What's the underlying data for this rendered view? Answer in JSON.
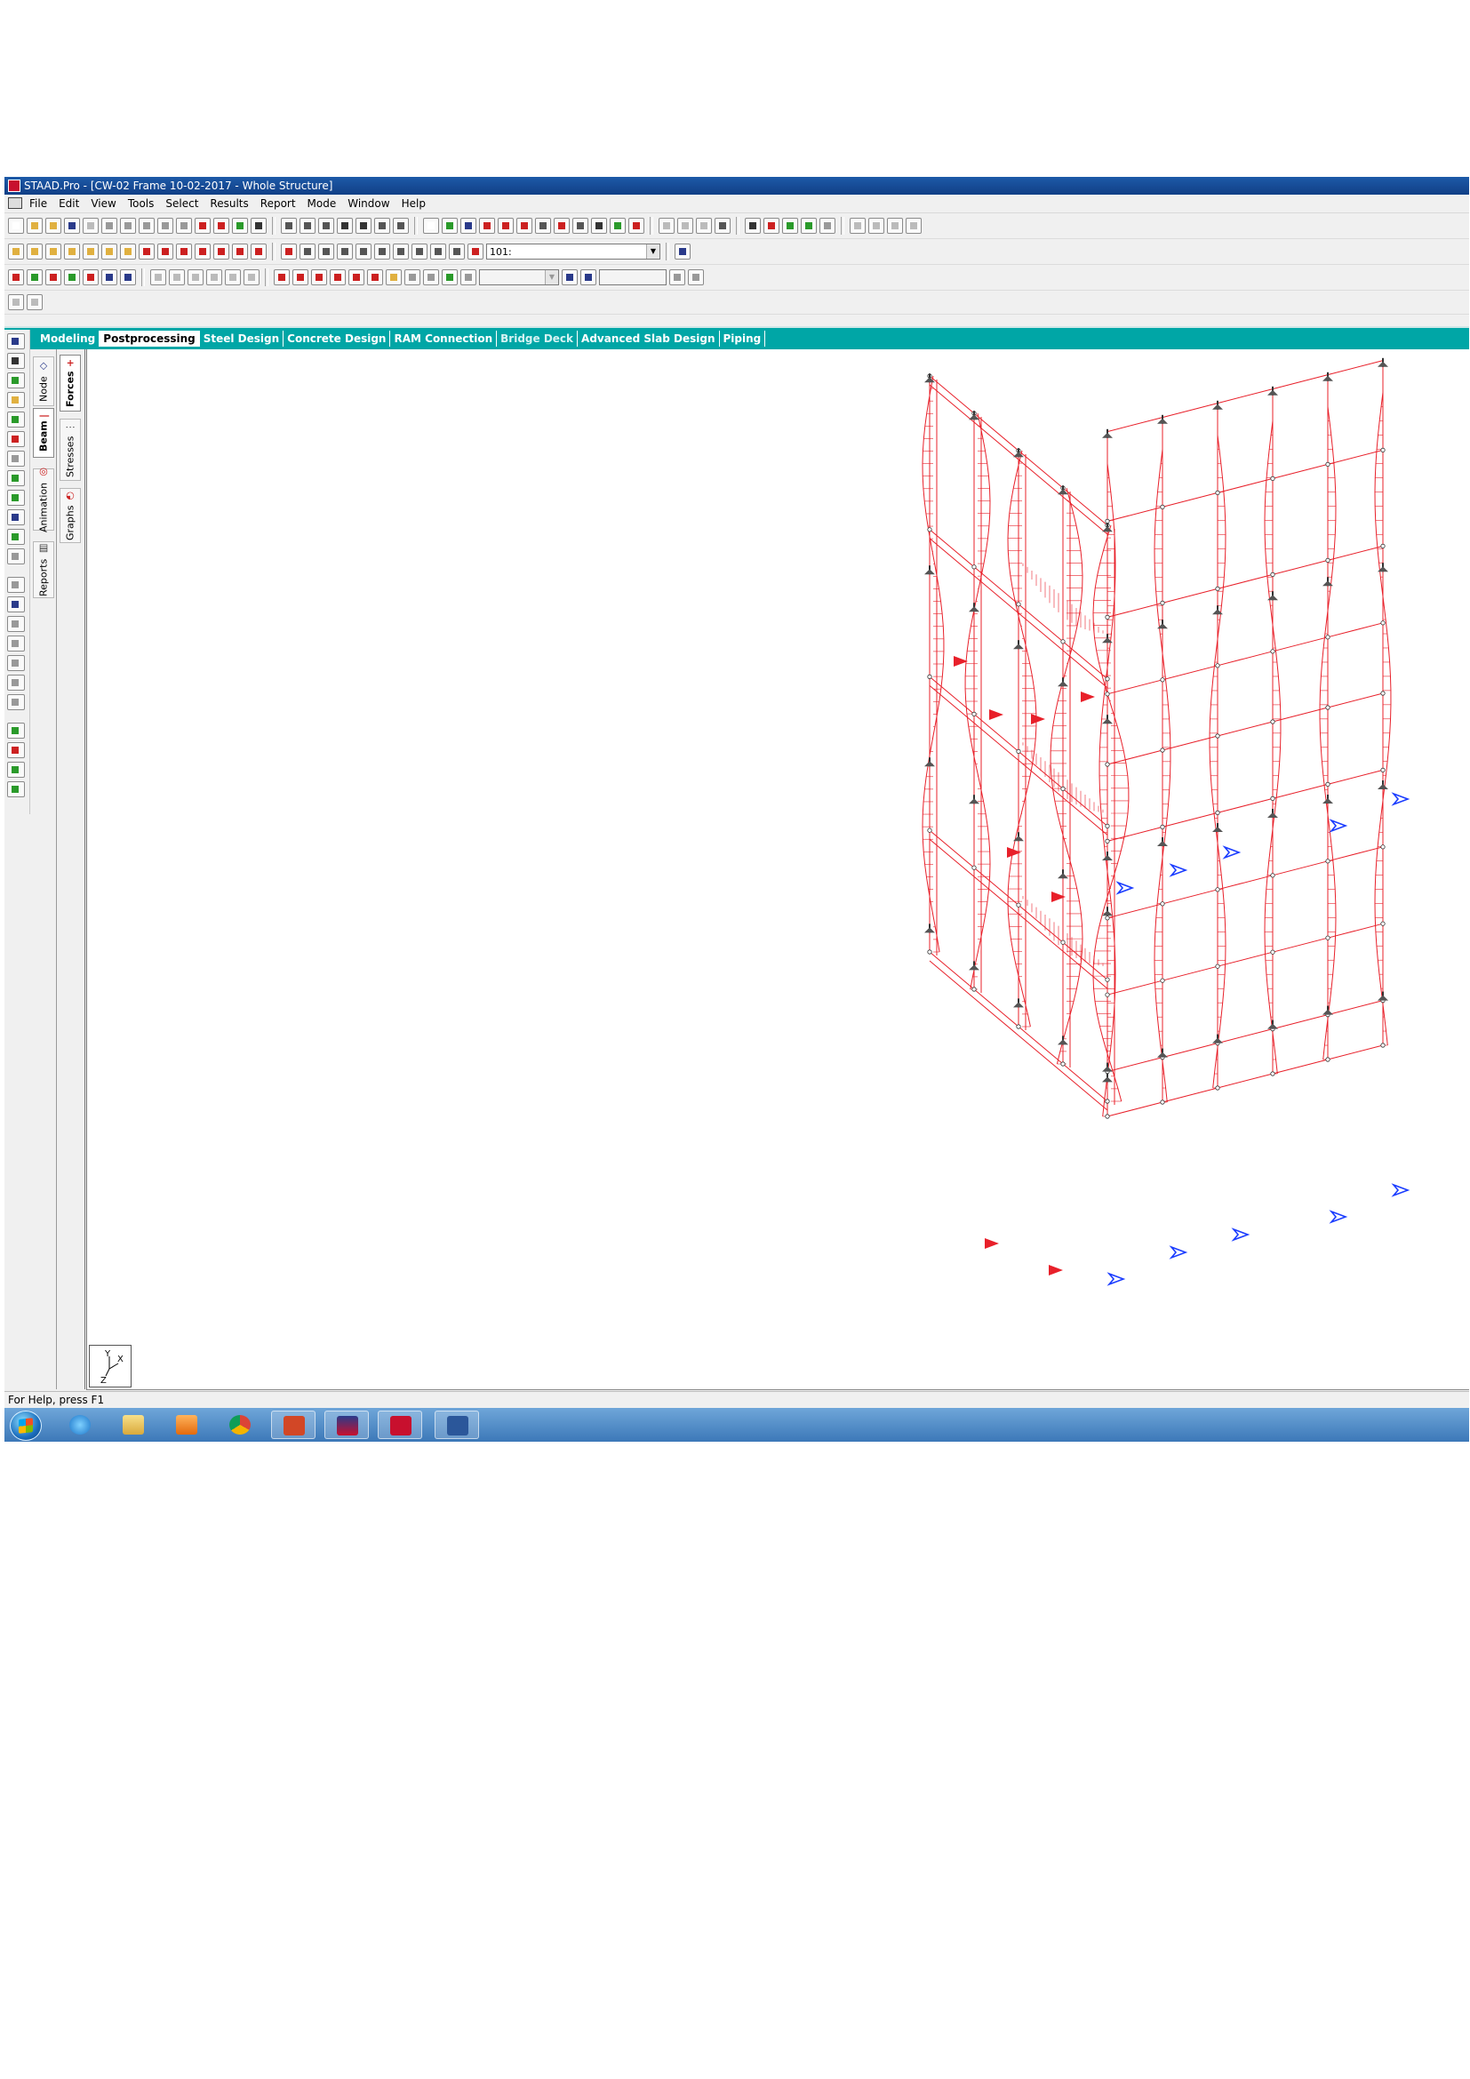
{
  "window": {
    "title": "STAAD.Pro - [CW-02 Frame 10-02-2017 - Whole Structure]"
  },
  "menu": [
    "File",
    "Edit",
    "View",
    "Tools",
    "Select",
    "Results",
    "Report",
    "Mode",
    "Window",
    "Help"
  ],
  "toolbar": {
    "load_case_value": "101:",
    "help_icon": "help-icon"
  },
  "page_tabs": [
    {
      "label": "Modeling",
      "state": "normal"
    },
    {
      "label": "Postprocessing",
      "state": "active"
    },
    {
      "label": "Steel Design",
      "state": "normal"
    },
    {
      "label": "Concrete Design",
      "state": "normal"
    },
    {
      "label": "RAM Connection",
      "state": "normal"
    },
    {
      "label": "Bridge Deck",
      "state": "dim"
    },
    {
      "label": "Advanced Slab Design",
      "state": "normal"
    },
    {
      "label": "Piping",
      "state": "normal"
    }
  ],
  "side_tabs_outer": {
    "node": "Node",
    "beam": "Beam",
    "animation": "Animation",
    "reports": "Reports"
  },
  "side_tabs_inner": {
    "forces": "Forces",
    "stresses": "Stresses",
    "graphs": "Graphs"
  },
  "axis_labels": {
    "y": "Y",
    "x": "X",
    "z": "Z"
  },
  "status_bar": "For Help, press F1",
  "colors": {
    "title_bar": "#1d5aa8",
    "page_tab_bar": "#00a6a6",
    "diagram_red": "#e8202a",
    "support_blue": "#1a3cff"
  }
}
